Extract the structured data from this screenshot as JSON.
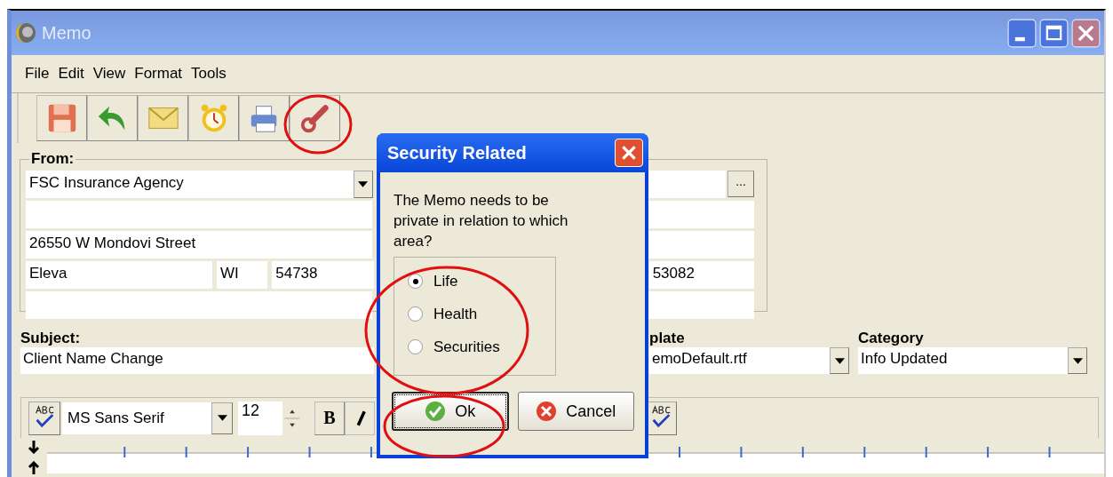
{
  "window": {
    "title": "Memo"
  },
  "menu": [
    "File",
    "Edit",
    "View",
    "Format",
    "Tools"
  ],
  "from": {
    "label": "From:",
    "company": "FSC Insurance Agency",
    "street": "26550 W Mondovi Street",
    "city": "Eleva",
    "state": "WI",
    "zip": "54738",
    "other_zip": "53082",
    "browse": "..."
  },
  "subject": {
    "label": "Subject:",
    "value": "Client Name Change"
  },
  "template": {
    "label": "plate",
    "value": "emoDefault.rtf"
  },
  "category": {
    "label": "Category",
    "value": "Info Updated"
  },
  "format_bar": {
    "font": "MS Sans Serif",
    "size": "12",
    "bold": "B"
  },
  "dialog": {
    "title": "Security Related",
    "message": "The Memo needs to be private in relation to which area?",
    "options": [
      {
        "label": "Life",
        "selected": true
      },
      {
        "label": "Health",
        "selected": false
      },
      {
        "label": "Securities",
        "selected": false
      }
    ],
    "buttons": [
      {
        "label": "Ok",
        "kind": "ok",
        "focused": true
      },
      {
        "label": "Cancel",
        "kind": "cancel",
        "focused": false
      }
    ]
  }
}
